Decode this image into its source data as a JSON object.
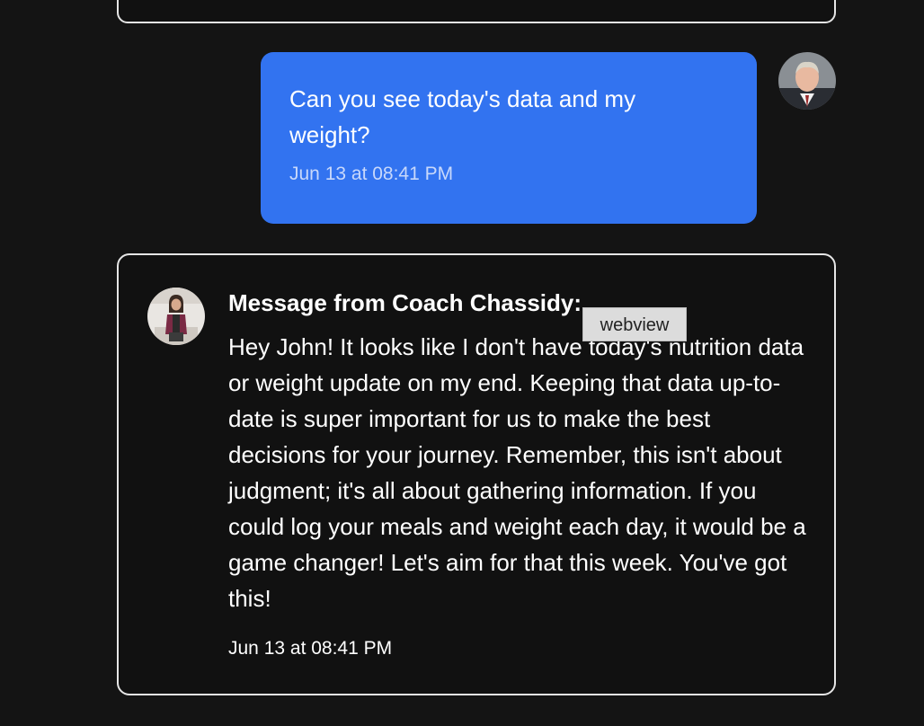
{
  "colors": {
    "background": "#141414",
    "user_bubble": "#3273f0",
    "card_border": "#e6e6e6",
    "text": "#ffffff",
    "tooltip_bg": "#dcdcdc"
  },
  "messages": [
    {
      "sender": "user",
      "text": "Can you see today's data and my weight?",
      "time": "Jun 13 at 08:41 PM",
      "avatar_icon": "user-avatar"
    },
    {
      "sender": "coach",
      "title": "Message from Coach Chassidy:",
      "text": "Hey John! It looks like I don't have today's nutrition data or weight update on my end. Keeping that data up-to-date is super important for us to make the best decisions for your journey. Remember, this isn't about judgment; it's all about gathering information. If you could log your meals and weight each day, it would be a game changer! Let's aim for that this week. You've got this!",
      "time": "Jun 13 at 08:41 PM",
      "avatar_icon": "coach-avatar"
    }
  ],
  "tooltip": {
    "label": "webview"
  }
}
